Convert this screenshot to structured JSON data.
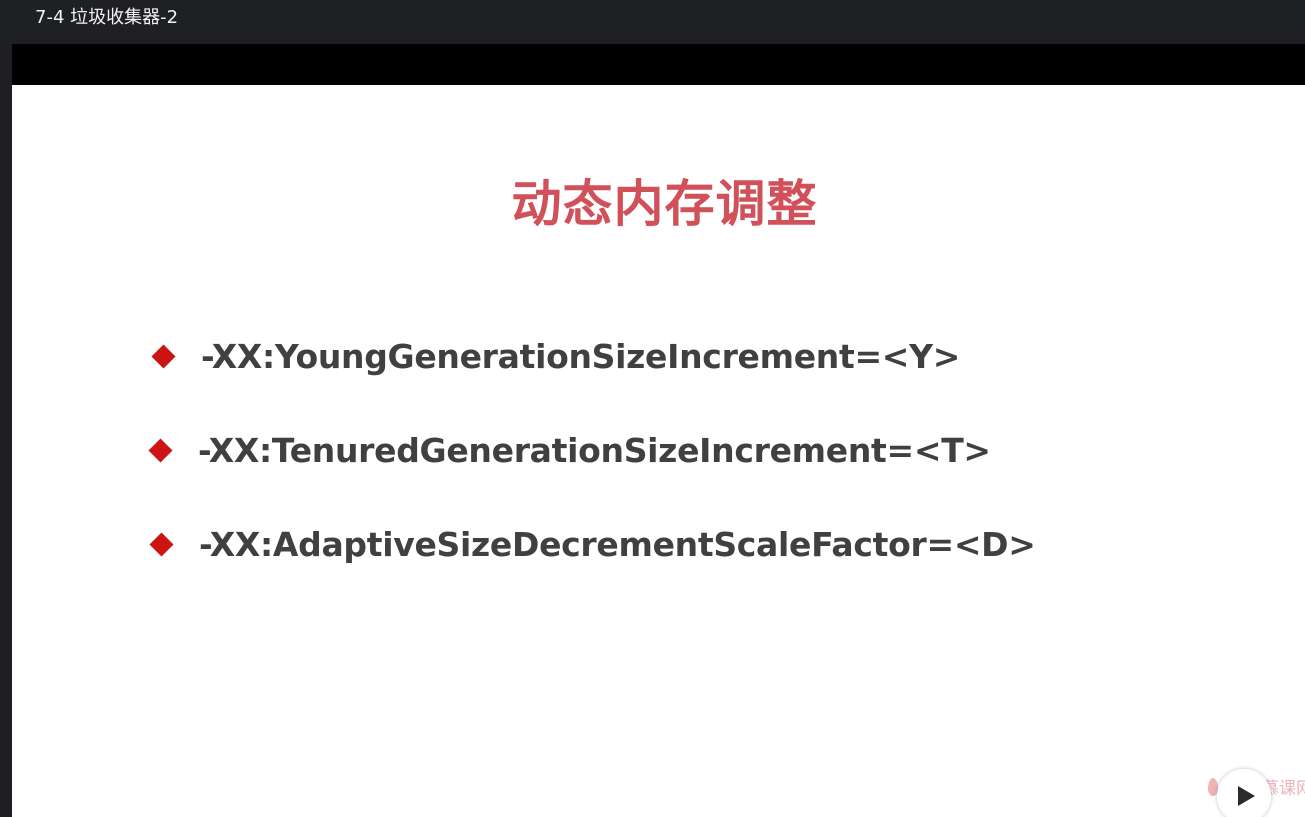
{
  "window": {
    "title": "7-4 垃圾收集器-2"
  },
  "slide": {
    "title": "动态内存调整",
    "bullets": [
      "-XX:YoungGenerationSizeIncrement=<Y>",
      "-XX:TenuredGenerationSizeIncrement=<T>",
      "-XX:AdaptiveSizeDecrementScaleFactor=<D>"
    ]
  },
  "player": {
    "watermark_text": "慕课网",
    "play_icon": "play-icon",
    "watermark_icon": "flame-icon"
  },
  "colors": {
    "title": "#d1515a",
    "bullet_marker": "#cc1414",
    "bullet_text": "#404040",
    "topbar": "#1f2023",
    "letterbox": "#000000"
  }
}
